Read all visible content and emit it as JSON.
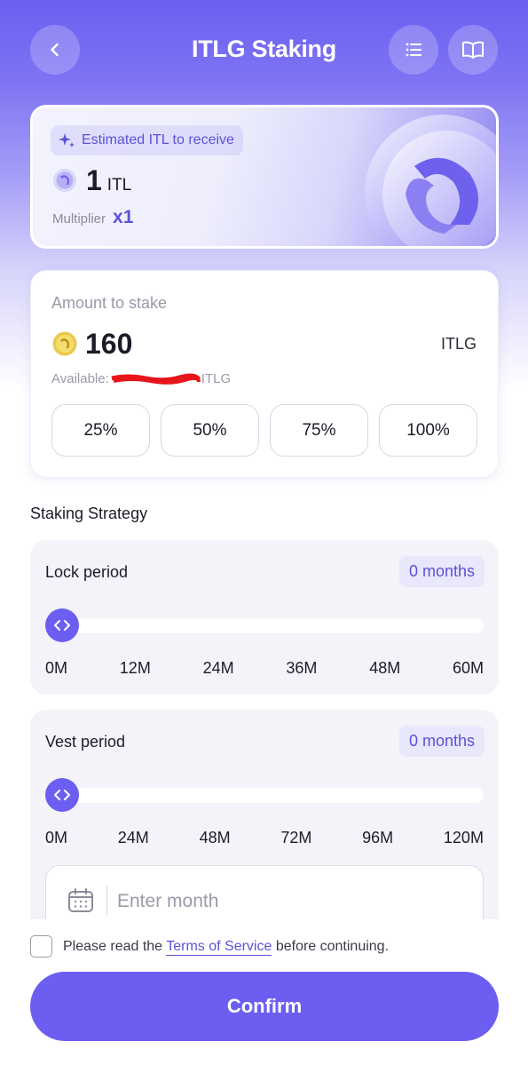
{
  "header": {
    "title": "ITLG Staking",
    "back_icon": "chevron-left-icon",
    "list_icon": "list-icon",
    "book_icon": "book-icon"
  },
  "receive": {
    "chip_label": "Estimated ITL to receive",
    "amount": "1",
    "unit": "ITL",
    "multiplier_label": "Multiplier",
    "multiplier_value": "x1"
  },
  "stake": {
    "label": "Amount to stake",
    "amount": "160",
    "unit": "ITLG",
    "available_label": "Available:",
    "available_unit": "ITLG",
    "percent_options": [
      "25%",
      "50%",
      "75%",
      "100%"
    ]
  },
  "strategy": {
    "title": "Staking Strategy",
    "lock": {
      "label": "Lock period",
      "value": "0 months",
      "ticks": [
        "0M",
        "12M",
        "24M",
        "36M",
        "48M",
        "60M"
      ],
      "level": 0
    },
    "vest": {
      "label": "Vest period",
      "value": "0 months",
      "ticks": [
        "0M",
        "24M",
        "48M",
        "72M",
        "96M",
        "120M"
      ],
      "level": 0,
      "input_placeholder": "Enter month"
    }
  },
  "footer": {
    "terms_prefix": "Please read the ",
    "terms_link": "Terms of Service",
    "terms_suffix": " before continuing.",
    "confirm_label": "Confirm"
  },
  "colors": {
    "accent": "#6b5ef0",
    "accent_text": "#5a52d6",
    "header_gradient_top": "#6a5ff0"
  }
}
